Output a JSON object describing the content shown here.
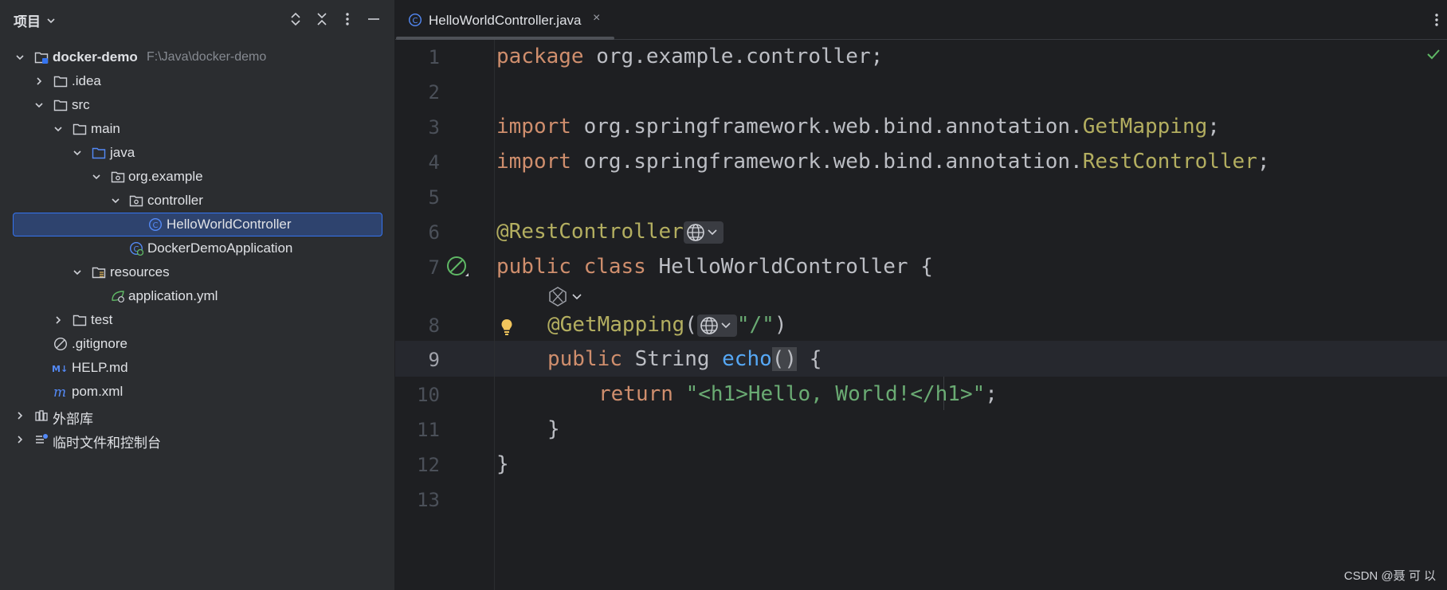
{
  "sidebar": {
    "title": "项目",
    "tree": [
      {
        "label": "docker-demo",
        "path": "F:\\Java\\docker-demo",
        "depth": 0,
        "expanded": true,
        "icon": "module-folder-icon",
        "bold": true
      },
      {
        "label": ".idea",
        "depth": 1,
        "expanded": false,
        "icon": "folder-icon"
      },
      {
        "label": "src",
        "depth": 1,
        "expanded": true,
        "icon": "folder-icon"
      },
      {
        "label": "main",
        "depth": 2,
        "expanded": true,
        "icon": "folder-icon"
      },
      {
        "label": "java",
        "depth": 3,
        "expanded": true,
        "icon": "source-folder-icon"
      },
      {
        "label": "org.example",
        "depth": 4,
        "expanded": true,
        "icon": "package-icon"
      },
      {
        "label": "controller",
        "depth": 5,
        "expanded": true,
        "icon": "package-icon"
      },
      {
        "label": "HelloWorldController",
        "depth": 6,
        "icon": "class-icon",
        "selected": true
      },
      {
        "label": "DockerDemoApplication",
        "depth": 5,
        "icon": "spring-class-icon"
      },
      {
        "label": "resources",
        "depth": 3,
        "expanded": true,
        "icon": "resources-folder-icon"
      },
      {
        "label": "application.yml",
        "depth": 4,
        "icon": "spring-yml-icon"
      },
      {
        "label": "test",
        "depth": 2,
        "expanded": false,
        "icon": "folder-icon"
      },
      {
        "label": ".gitignore",
        "depth": 1,
        "icon": "ignore-file-icon"
      },
      {
        "label": "HELP.md",
        "depth": 1,
        "icon": "markdown-icon"
      },
      {
        "label": "pom.xml",
        "depth": 1,
        "icon": "maven-icon"
      },
      {
        "label": "外部库",
        "depth": 0,
        "expanded": false,
        "icon": "library-icon"
      },
      {
        "label": "临时文件和控制台",
        "depth": 0,
        "expanded": false,
        "icon": "scratch-icon"
      }
    ]
  },
  "editor": {
    "tab": {
      "label": "HelloWorldController.java",
      "close": "×"
    },
    "current_line": 9,
    "line_numbers": [
      "1",
      "2",
      "3",
      "4",
      "5",
      "6",
      "7",
      "8",
      "9",
      "10",
      "11",
      "12",
      "13"
    ],
    "code": {
      "l1_kw": "package",
      "l1_rest": " org.example.controller;",
      "l3_kw": "import",
      "l3_pkg": " org.springframework.web.bind.annotation.",
      "l3_cls": "GetMapping",
      "l3_end": ";",
      "l4_kw": "import",
      "l4_pkg": " org.springframework.web.bind.annotation.",
      "l4_cls": "RestController",
      "l4_end": ";",
      "l6_ann": "@RestController",
      "l7_kw": "public class",
      "l7_rest": " HelloWorldController {",
      "l8_ann": "@GetMapping",
      "l8_open": "(",
      "l8_str": "\"/\"",
      "l8_close": ")",
      "l9_kw": "public",
      "l9_type": " String ",
      "l9_fn": "echo",
      "l9_paren": "()",
      "l9_brace": " {",
      "l10_kw": "return",
      "l10_str": " \"<h1>Hello, World!</h1>\"",
      "l10_end": ";",
      "l11": "}",
      "l12": "}"
    }
  },
  "colors": {
    "keyword": "#cf8e6d",
    "annotation": "#b3ae60",
    "string": "#6aab73",
    "method": "#56a8f5",
    "selection": "#2e436e",
    "accent": "#3574f0",
    "check": "#5fb865"
  },
  "watermark": "CSDN @聂 可 以"
}
